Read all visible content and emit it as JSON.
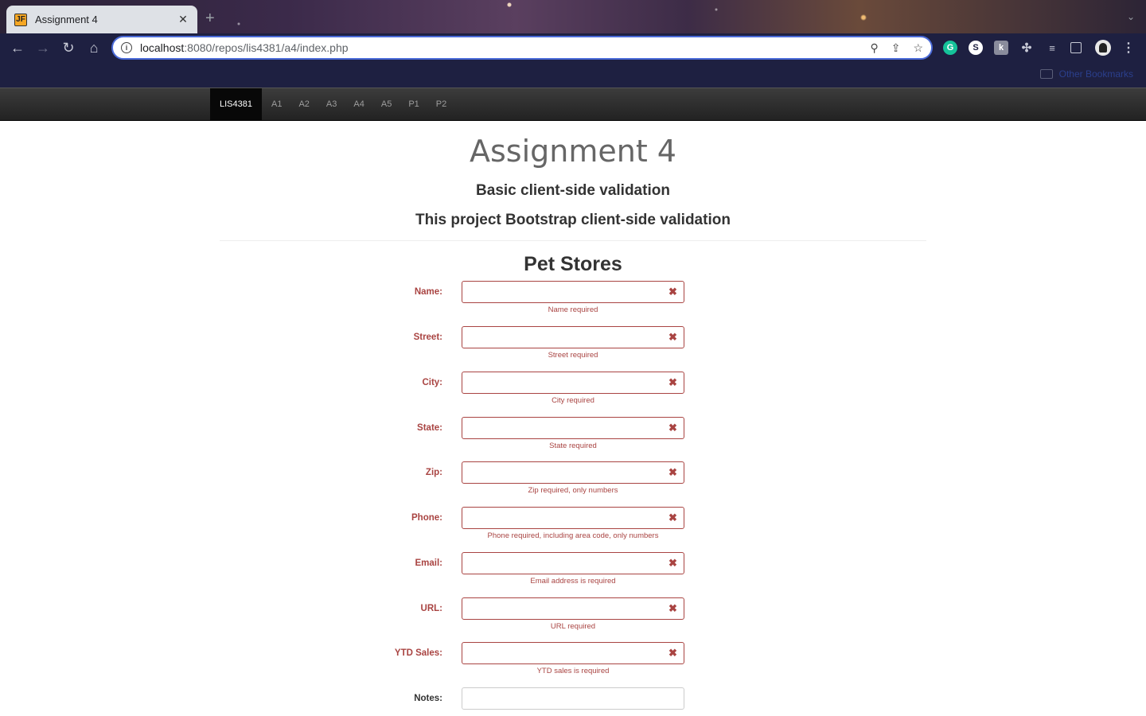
{
  "browser": {
    "tab_title": "Assignment 4",
    "tab_favicon_text": "JF",
    "tab_close": "✕",
    "new_tab": "+",
    "url_host": "localhost",
    "url_rest": ":8080/repos/lis4381/a4/index.php",
    "bookmarks_folder": "Other Bookmarks",
    "extensions": [
      "grammarly-icon",
      "s-extension-icon",
      "k-extension-icon",
      "puzzle-icon",
      "media-icon",
      "sidepanel-icon",
      "avatar",
      "menu-icon"
    ]
  },
  "navbar": {
    "brand": "LIS4381",
    "links": [
      "A1",
      "A2",
      "A3",
      "A4",
      "A5",
      "P1",
      "P2"
    ]
  },
  "page": {
    "title": "Assignment 4",
    "subtitle1": "Basic client-side validation",
    "subtitle2": "This project Bootstrap client-side validation",
    "form_title": "Pet Stores"
  },
  "form": {
    "fields": [
      {
        "label": "Name:",
        "error": "Name required"
      },
      {
        "label": "Street:",
        "error": "Street required"
      },
      {
        "label": "City:",
        "error": "City required"
      },
      {
        "label": "State:",
        "error": "State required"
      },
      {
        "label": "Zip:",
        "error": "Zip required, only numbers"
      },
      {
        "label": "Phone:",
        "error": "Phone required, including area code, only numbers"
      },
      {
        "label": "Email:",
        "error": "Email address is required"
      },
      {
        "label": "URL:",
        "error": "URL required"
      },
      {
        "label": "YTD Sales:",
        "error": "YTD sales is required"
      },
      {
        "label": "Notes:",
        "error": ""
      }
    ],
    "error_icon": "✖"
  },
  "colors": {
    "error": "#a94442",
    "navbar": "#222222",
    "toolbar": "#1e2041"
  }
}
